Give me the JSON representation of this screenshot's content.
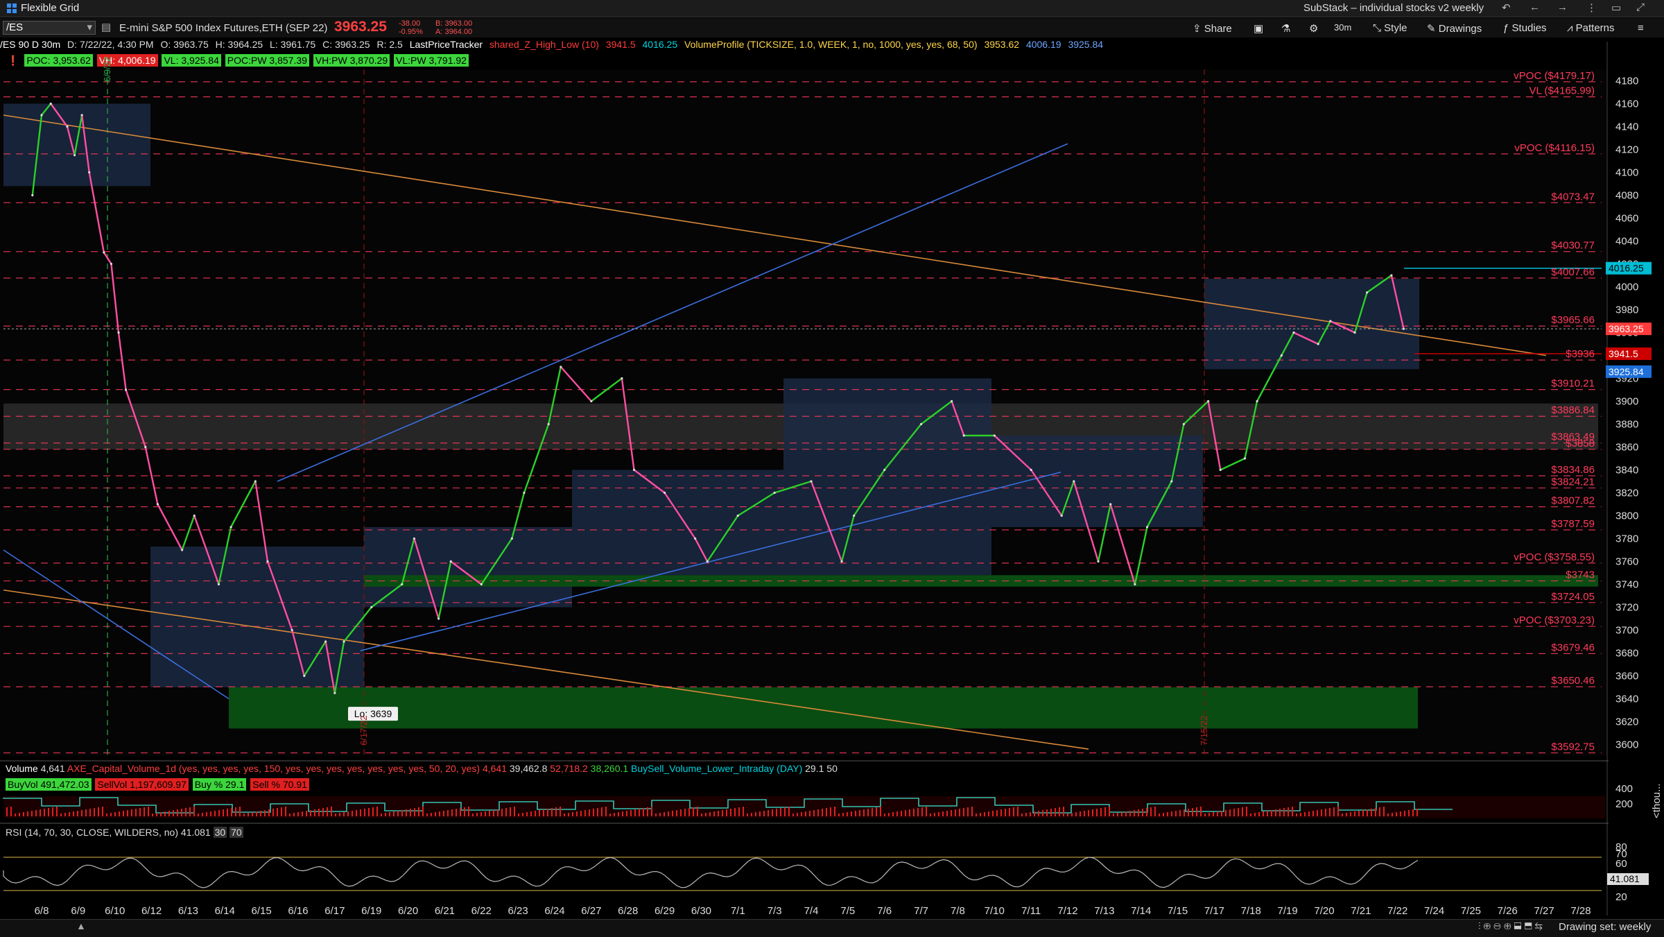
{
  "topbar": {
    "window_title": "Flexible Grid",
    "right_title": "SubStack – individual stocks v2 weekly"
  },
  "header": {
    "symbol": "/ES",
    "description": "E-mini S&P 500 Index Futures,ETH (SEP 22)",
    "last_price": "3963.25",
    "change": "-38.00",
    "change_pct": "-0.95%",
    "bid": "B: 3963.00",
    "ask": "A: 3964.00",
    "buttons": {
      "share": "Share",
      "interval": "30m",
      "style": "Style",
      "drawings": "Drawings",
      "studies": "Studies",
      "patterns": "Patterns"
    }
  },
  "study_line": {
    "chart_info": "/ES 90 D 30m",
    "date": "D: 7/22/22, 4:30 PM",
    "open": "O: 3963.75",
    "high": "H: 3964.25",
    "low": "L: 3961.75",
    "close": "C: 3963.25",
    "range": "R: 2.5",
    "tracker": "LastPriceTracker",
    "shared_low_name": "shared_Z_High_Low (10)",
    "shared_low_v1": "3941.5",
    "shared_low_v2": "4016.25",
    "vp_name": "VolumeProfile (TICKSIZE, 1.0, WEEK, 1, no, 1000, yes, yes, 68, 50)",
    "vp_v1": "3953.62",
    "vp_v2": "4006.19",
    "vp_v3": "3925.84"
  },
  "poc_tags": {
    "poc": "POC: 3,953.62",
    "vh": "VH: 4,006.19",
    "vl": "VL: 3,925.84",
    "poc_pw": "POC:PW 3,857.39",
    "vh_pw": "VH:PW 3,870.29",
    "vl_pw": "VL:PW 3,791.92"
  },
  "levels": [
    {
      "label": "vPOC ($4179.17)",
      "price": 4179.17
    },
    {
      "label": "VL ($4165.99)",
      "price": 4165.99
    },
    {
      "label": "vPOC ($4116.15)",
      "price": 4116.15
    },
    {
      "label": "$4073.47",
      "price": 4073.47
    },
    {
      "label": "$4030.77",
      "price": 4030.77
    },
    {
      "label": "$4007.66",
      "price": 4007.66
    },
    {
      "label": "$3965.66",
      "price": 3965.66
    },
    {
      "label": "$3936",
      "price": 3936
    },
    {
      "label": "$3910.21",
      "price": 3910.21
    },
    {
      "label": "$3886.84",
      "price": 3886.84
    },
    {
      "label": "$3863.49",
      "price": 3863.49
    },
    {
      "label": "$3858",
      "price": 3858
    },
    {
      "label": "$3834.86",
      "price": 3834.86
    },
    {
      "label": "$3824.21",
      "price": 3824.21
    },
    {
      "label": "$3807.82",
      "price": 3807.82
    },
    {
      "label": "$3787.59",
      "price": 3787.59
    },
    {
      "label": "vPOC ($3758.55)",
      "price": 3758.55
    },
    {
      "label": "$3743",
      "price": 3743
    },
    {
      "label": "$3724.05",
      "price": 3724.05
    },
    {
      "label": "vPOC ($3703.23)",
      "price": 3703.23
    },
    {
      "label": "$3679.46",
      "price": 3679.46
    },
    {
      "label": "$3650.46",
      "price": 3650.46
    },
    {
      "label": "$3592.75",
      "price": 3592.75
    }
  ],
  "price_axis_tags": [
    {
      "text": "4016.25",
      "price": 4016.25,
      "bg": "#00bcd4",
      "fg": "#000"
    },
    {
      "text": "3963.25",
      "price": 3963.25,
      "bg": "#ff3b3b",
      "fg": "#fff"
    },
    {
      "text": "3941.5",
      "price": 3941.5,
      "bg": "#cc0000",
      "fg": "#fff"
    },
    {
      "text": "3925.84",
      "price": 3925.84,
      "bg": "#1e6fd9",
      "fg": "#fff"
    }
  ],
  "low_label": "Lo: 3639",
  "volume_header": {
    "title": "Volume",
    "v1": "4,641",
    "study": "AXE_Capital_Volume_1d (yes, yes, yes, yes, 150, yes, yes, yes, yes, yes, yes, yes, 50, 20, yes)",
    "v2": "4,641",
    "v3": "39,462.8",
    "v4": "52,718.2",
    "v5": "38,260.1",
    "study2": "BuySell_Volume_Lower_Intraday (DAY)",
    "v6": "29.1",
    "v7": "50"
  },
  "buysell_tags": {
    "buy": "BuyVol 491,472.03",
    "sell": "SellVol 1,197,609.97",
    "buy_pct": "Buy % 29.1",
    "sell_pct": "Sell % 70.91"
  },
  "volume_axis": [
    "400",
    "200"
  ],
  "volume_axis_unit": "<thou...",
  "rsi_header": {
    "title": "RSI (14, 70, 30, CLOSE, WILDERS, no)",
    "value": "41.081",
    "ob": "30",
    "os": "70"
  },
  "rsi_axis": [
    "80",
    "70",
    "60",
    "41.081",
    "20"
  ],
  "date_labels": [
    "6/8",
    "6/9",
    "6/10",
    "6/12",
    "6/13",
    "6/14",
    "6/15",
    "6/16",
    "6/17",
    "6/19",
    "6/20",
    "6/21",
    "6/22",
    "6/23",
    "6/24",
    "6/27",
    "6/28",
    "6/29",
    "6/30",
    "7/1",
    "7/3",
    "7/4",
    "7/5",
    "7/6",
    "7/7",
    "7/8",
    "7/10",
    "7/11",
    "7/12",
    "7/13",
    "7/14",
    "7/15",
    "7/17",
    "7/18",
    "7/19",
    "7/20",
    "7/21",
    "7/22",
    "7/24",
    "7/25",
    "7/26",
    "7/27",
    "7/28"
  ],
  "vertical_markers": [
    "6/9/22",
    "6/17/22",
    "7/15/22"
  ],
  "bottom": {
    "drawing_set": "Drawing set: weekly"
  },
  "colors": {
    "level_line": "#ff3b5c",
    "level_label": "#ff3b5c",
    "green_zone": "#0a4d12",
    "up_candle": "#2ad12a",
    "down_candle": "#ff4fa3",
    "trend_blue": "#3b6fe0",
    "trend_orange": "#d98a3a"
  },
  "chart_data": {
    "type": "line",
    "title": "/ES 90 D 30m",
    "x_range": [
      "6/8",
      "7/28"
    ],
    "ylim": [
      3590,
      4190
    ],
    "y_ticks": [
      4180,
      4160,
      4140,
      4120,
      4100,
      4080,
      4060,
      4040,
      4020,
      4000,
      3980,
      3960,
      3940,
      3920,
      3900,
      3880,
      3860,
      3840,
      3820,
      3800,
      3780,
      3760,
      3740,
      3720,
      3700,
      3680,
      3660,
      3640,
      3620,
      3600
    ],
    "series": [
      {
        "values": [
          {
            "x": "6/8",
            "y": 4080
          },
          {
            "x": "6/8",
            "y": 4150
          },
          {
            "x": "6/8",
            "y": 4160
          },
          {
            "x": "6/9",
            "y": 4140
          },
          {
            "x": "6/9",
            "y": 4115
          },
          {
            "x": "6/9",
            "y": 4150
          },
          {
            "x": "6/9",
            "y": 4100
          },
          {
            "x": "6/10",
            "y": 4030
          },
          {
            "x": "6/10",
            "y": 4020
          },
          {
            "x": "6/10",
            "y": 3960
          },
          {
            "x": "6/10",
            "y": 3910
          },
          {
            "x": "6/12",
            "y": 3860
          },
          {
            "x": "6/12",
            "y": 3810
          },
          {
            "x": "6/13",
            "y": 3770
          },
          {
            "x": "6/13",
            "y": 3800
          },
          {
            "x": "6/14",
            "y": 3740
          },
          {
            "x": "6/14",
            "y": 3790
          },
          {
            "x": "6/15",
            "y": 3830
          },
          {
            "x": "6/15",
            "y": 3760
          },
          {
            "x": "6/16",
            "y": 3700
          },
          {
            "x": "6/16",
            "y": 3660
          },
          {
            "x": "6/17",
            "y": 3690
          },
          {
            "x": "6/17",
            "y": 3645
          },
          {
            "x": "6/17",
            "y": 3690
          },
          {
            "x": "6/19",
            "y": 3720
          },
          {
            "x": "6/20",
            "y": 3740
          },
          {
            "x": "6/20",
            "y": 3780
          },
          {
            "x": "6/21",
            "y": 3710
          },
          {
            "x": "6/21",
            "y": 3760
          },
          {
            "x": "6/22",
            "y": 3740
          },
          {
            "x": "6/23",
            "y": 3780
          },
          {
            "x": "6/23",
            "y": 3820
          },
          {
            "x": "6/24",
            "y": 3880
          },
          {
            "x": "6/24",
            "y": 3930
          },
          {
            "x": "6/27",
            "y": 3900
          },
          {
            "x": "6/28",
            "y": 3920
          },
          {
            "x": "6/28",
            "y": 3840
          },
          {
            "x": "6/29",
            "y": 3820
          },
          {
            "x": "6/30",
            "y": 3780
          },
          {
            "x": "6/30",
            "y": 3760
          },
          {
            "x": "7/1",
            "y": 3800
          },
          {
            "x": "7/3",
            "y": 3820
          },
          {
            "x": "7/4",
            "y": 3830
          },
          {
            "x": "7/5",
            "y": 3760
          },
          {
            "x": "7/5",
            "y": 3800
          },
          {
            "x": "7/6",
            "y": 3840
          },
          {
            "x": "7/7",
            "y": 3880
          },
          {
            "x": "7/8",
            "y": 3900
          },
          {
            "x": "7/8",
            "y": 3870
          },
          {
            "x": "7/10",
            "y": 3870
          },
          {
            "x": "7/11",
            "y": 3840
          },
          {
            "x": "7/12",
            "y": 3800
          },
          {
            "x": "7/12",
            "y": 3830
          },
          {
            "x": "7/13",
            "y": 3760
          },
          {
            "x": "7/13",
            "y": 3810
          },
          {
            "x": "7/14",
            "y": 3740
          },
          {
            "x": "7/14",
            "y": 3790
          },
          {
            "x": "7/15",
            "y": 3830
          },
          {
            "x": "7/15",
            "y": 3880
          },
          {
            "x": "7/17",
            "y": 3900
          },
          {
            "x": "7/17",
            "y": 3840
          },
          {
            "x": "7/18",
            "y": 3850
          },
          {
            "x": "7/18",
            "y": 3900
          },
          {
            "x": "7/19",
            "y": 3940
          },
          {
            "x": "7/19",
            "y": 3960
          },
          {
            "x": "7/20",
            "y": 3950
          },
          {
            "x": "7/20",
            "y": 3970
          },
          {
            "x": "7/21",
            "y": 3960
          },
          {
            "x": "7/21",
            "y": 3995
          },
          {
            "x": "7/22",
            "y": 4010
          },
          {
            "x": "7/22",
            "y": 3963.25
          }
        ]
      }
    ]
  }
}
